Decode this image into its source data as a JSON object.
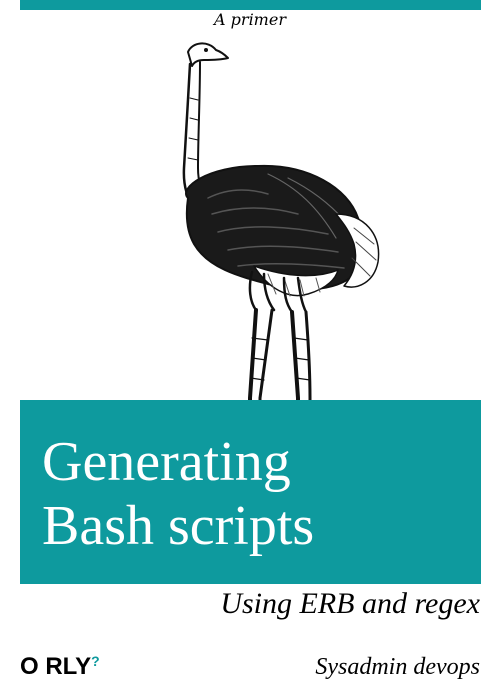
{
  "cover": {
    "tagline": "A primer",
    "title_line1": "Generating",
    "title_line2": "Bash scripts",
    "subtitle": "Using ERB and regex",
    "publisher": "O RLY",
    "publisher_mark": "?",
    "author": "Sysadmin devops",
    "animal": "ostrich"
  },
  "colors": {
    "accent": "#0e9a9e",
    "publisher_mark": "#0e9a9e",
    "text": "#000000",
    "title_text": "#ffffff"
  }
}
